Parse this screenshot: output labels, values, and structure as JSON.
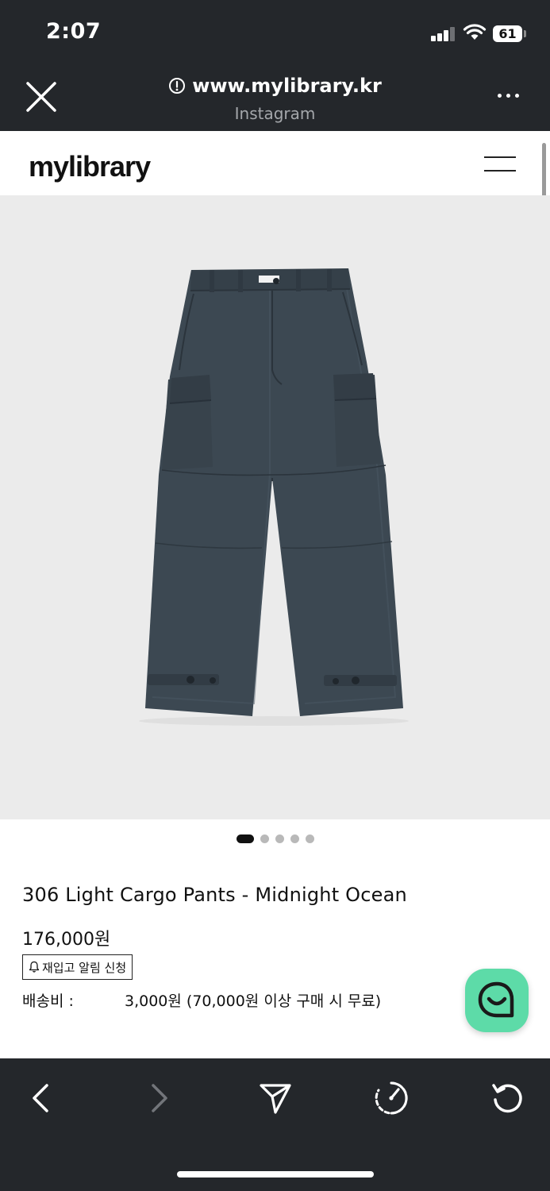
{
  "status_bar": {
    "time": "2:07",
    "battery": "61"
  },
  "browser": {
    "url": "www.mylibrary.kr",
    "source": "Instagram"
  },
  "site": {
    "logo": "mylibrary"
  },
  "carousel": {
    "total": 5,
    "active_index": 0
  },
  "product": {
    "title": "306 Light Cargo Pants - Midnight Ocean",
    "price": "176,000원",
    "restock_label": "재입고 알림 신청",
    "shipping_label": "배송비 :",
    "shipping_value": "3,000원 (70,000원 이상 구매 시 무료)",
    "color": "#3c4852"
  },
  "toolbar": {
    "icons": [
      "back-arrow-icon",
      "forward-arrow-icon",
      "share-icon",
      "speed-icon",
      "refresh-icon"
    ]
  },
  "colors": {
    "chrome": "#24272b",
    "chat_button": "#5ddba8",
    "image_background": "#ebebeb"
  }
}
